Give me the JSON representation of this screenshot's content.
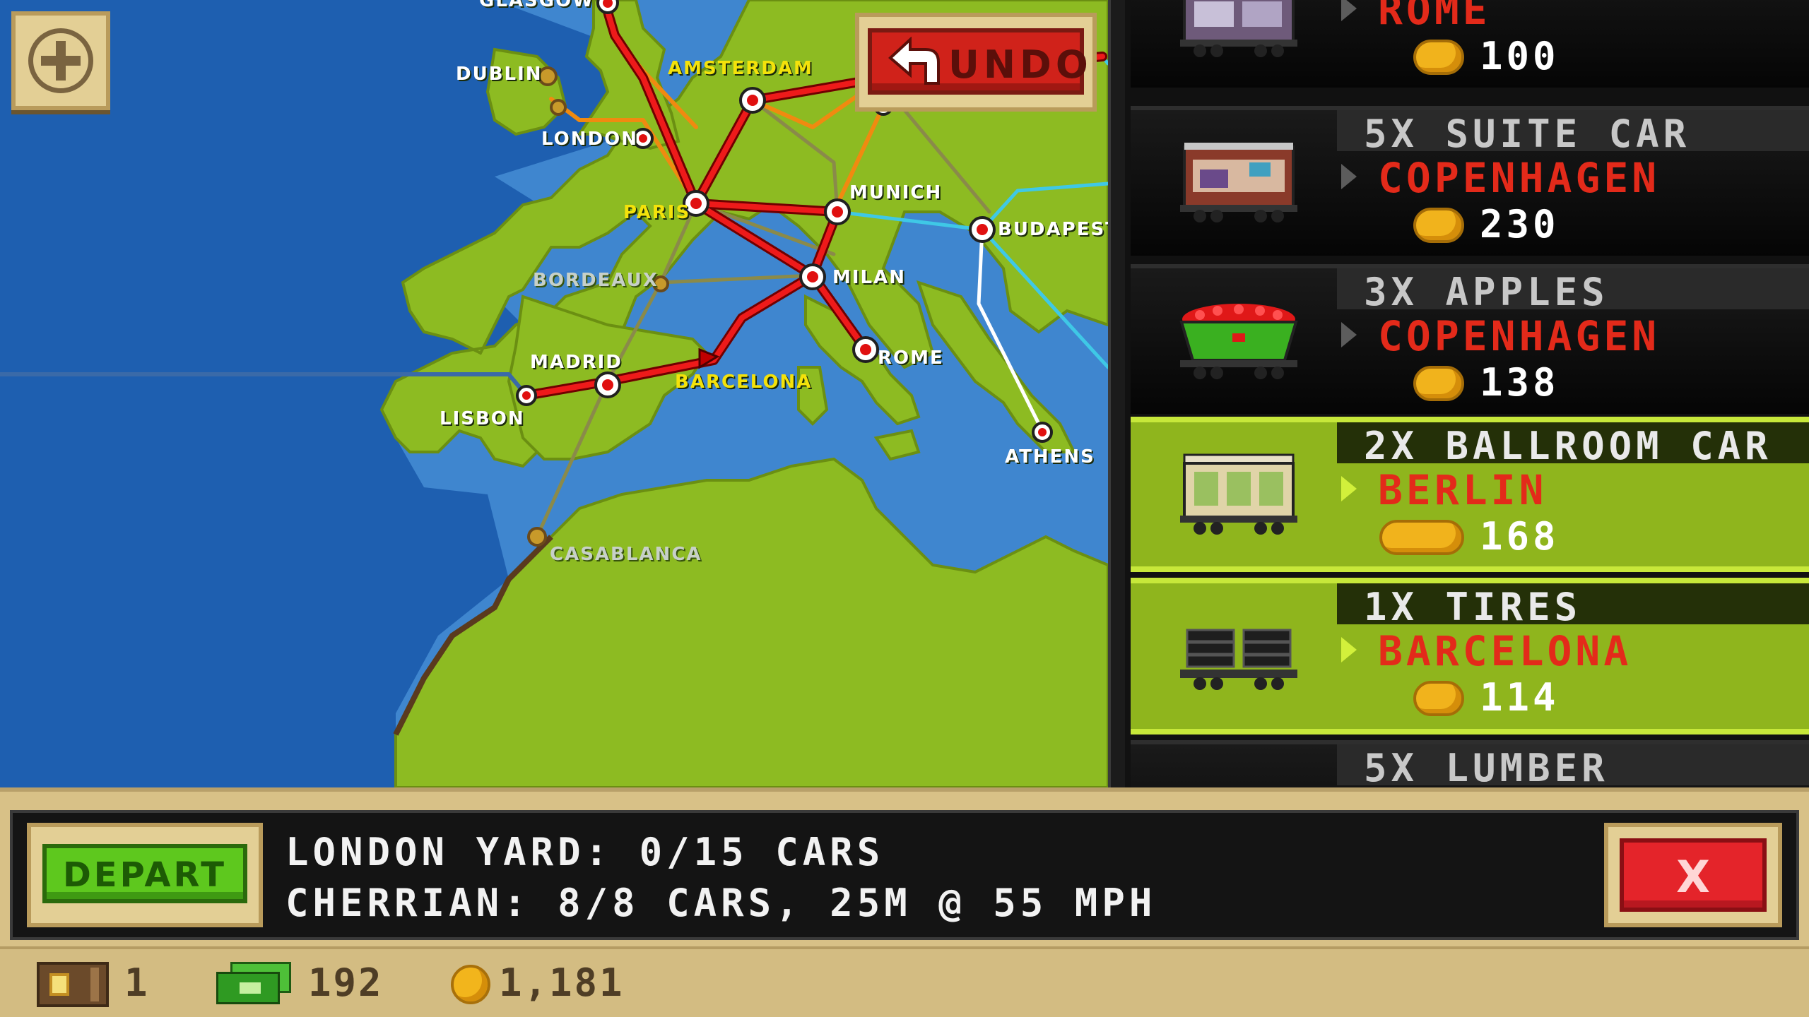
{
  "map": {
    "cities": [
      {
        "name": "GLASGOW",
        "style": "white"
      },
      {
        "name": "DUBLIN",
        "style": "white"
      },
      {
        "name": "AMSTERDAM",
        "style": "yellow"
      },
      {
        "name": "LONDON",
        "style": "white"
      },
      {
        "name": "PARIS",
        "style": "yellow"
      },
      {
        "name": "MUNICH",
        "style": "white"
      },
      {
        "name": "BUDAPEST",
        "style": "white"
      },
      {
        "name": "BORDEAUX",
        "style": "grey"
      },
      {
        "name": "MILAN",
        "style": "white"
      },
      {
        "name": "MADRID",
        "style": "white"
      },
      {
        "name": "BARCELONA",
        "style": "yellow"
      },
      {
        "name": "ROME",
        "style": "white"
      },
      {
        "name": "LISBON",
        "style": "white"
      },
      {
        "name": "ATHENS",
        "style": "white"
      },
      {
        "name": "CASABLANCA",
        "style": "grey"
      }
    ],
    "zoom_icon": "plus-icon",
    "undo_label": "UNDO",
    "colors": {
      "sea": "#1e5fb0",
      "land": "#8dbb22",
      "route_active": "#e01010",
      "route_orange": "#f08a10",
      "route_cyan": "#3fc8e6"
    }
  },
  "cargo": [
    {
      "name": "",
      "destination": "ROME",
      "reward": "100",
      "car_icon": "suite-car-icon",
      "selected": false
    },
    {
      "name": "5X SUITE CAR",
      "destination": "COPENHAGEN",
      "reward": "230",
      "car_icon": "suite-car-icon",
      "selected": false
    },
    {
      "name": "3X APPLES",
      "destination": "COPENHAGEN",
      "reward": "138",
      "car_icon": "hopper-car-icon",
      "selected": false
    },
    {
      "name": "2X BALLROOM CAR",
      "destination": "BERLIN",
      "reward": "168",
      "car_icon": "ballroom-car-icon",
      "selected": true
    },
    {
      "name": "1X TIRES",
      "destination": "BARCELONA",
      "reward": "114",
      "car_icon": "flatcar-tires-icon",
      "selected": true
    },
    {
      "name": "5X LUMBER",
      "destination": "",
      "reward": "",
      "car_icon": "",
      "selected": false
    }
  ],
  "panel": {
    "depart_label": "DEPART",
    "yard_line": "LONDON YARD: 0/15 CARS",
    "train_line": "CHERRIAN: 8/8 CARS, 25M @ 55 MPH",
    "close_label": "X"
  },
  "status": {
    "tickets": "1",
    "cash": "192",
    "coins": "1,181"
  }
}
